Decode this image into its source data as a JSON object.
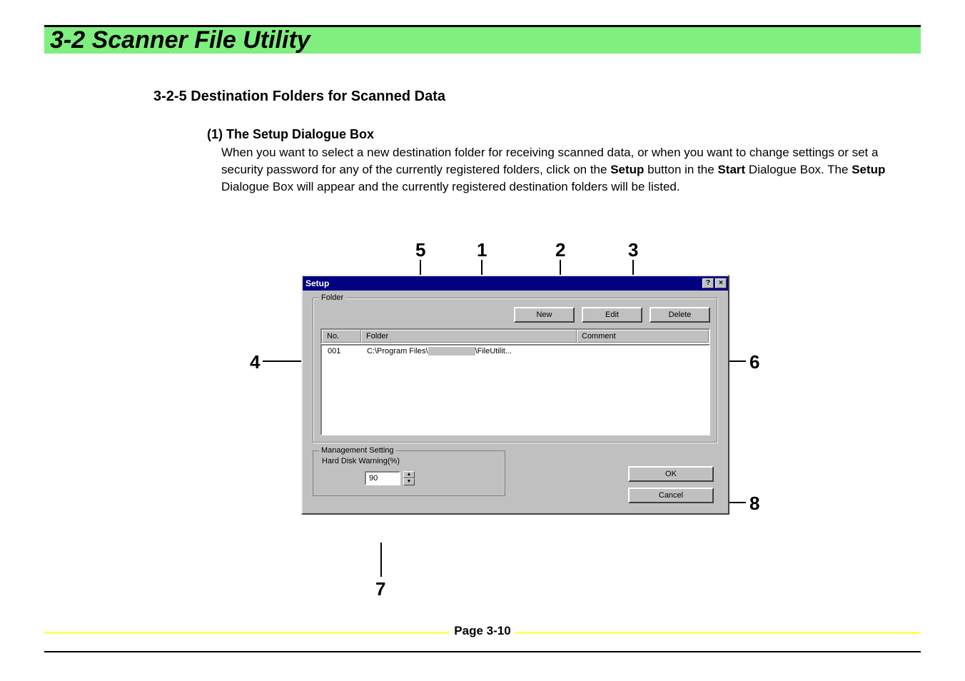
{
  "header": {
    "title": "3-2  Scanner File Utility"
  },
  "section": {
    "title": "3-2-5   Destination Folders for Scanned Data"
  },
  "subsection": {
    "title": "(1) The Setup Dialogue Box"
  },
  "body": {
    "line1a": "When you want to select a new destination folder for receiving scanned data, or when you want to change settings or set a security password for any of the currently registered folders, click on the ",
    "setup_bold": "Setup",
    "line1b": " button in the ",
    "start_bold": "Start",
    "line1c": " Dialogue Box. The ",
    "setup_bold2": "Setup",
    "line1d": " Dialogue Box will appear and the currently registered destination folders will be listed."
  },
  "callouts": {
    "c1": "1",
    "c2": "2",
    "c3": "3",
    "c4": "4",
    "c5": "5",
    "c6": "6",
    "c7": "7",
    "c8": "8"
  },
  "dialog": {
    "title": "Setup",
    "group_folder": "Folder",
    "btn_new": "New",
    "btn_edit": "Edit",
    "btn_delete": "Delete",
    "col_no": "No.",
    "col_folder": "Folder",
    "col_comment": "Comment",
    "row1_no": "001",
    "row1_folder": "C:\\Program Files\\",
    "row1_folder_suffix": "\\FileUtilit...",
    "group_mgmt": "Management Setting",
    "hdd_label": "Hard Disk Warning(%)",
    "hdd_value": "90",
    "ok": "OK",
    "cancel": "Cancel",
    "help": "?",
    "close": "×"
  },
  "footer": {
    "page": "Page 3-10"
  }
}
